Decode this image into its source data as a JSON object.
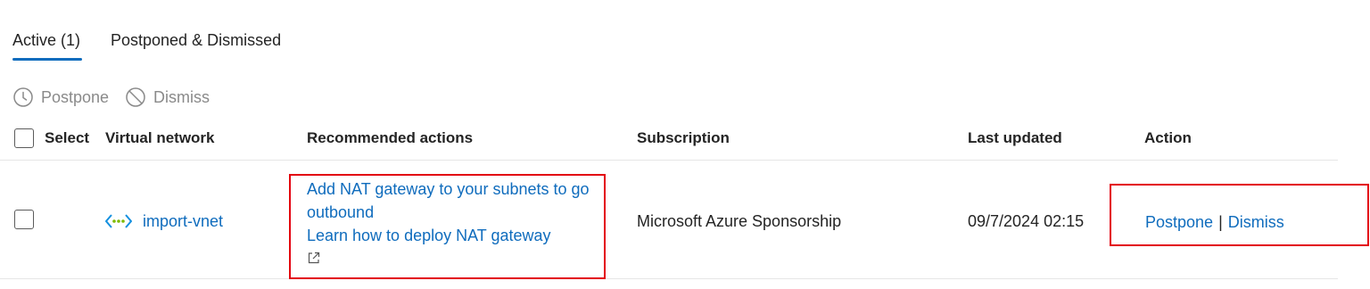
{
  "tabs": [
    {
      "label": "Active (1)",
      "active": true
    },
    {
      "label": "Postponed & Dismissed",
      "active": false
    }
  ],
  "toolbar": {
    "postpone_label": "Postpone",
    "dismiss_label": "Dismiss"
  },
  "table": {
    "headers": {
      "select": "Select",
      "virtual_network": "Virtual network",
      "recommended_actions": "Recommended actions",
      "subscription": "Subscription",
      "last_updated": "Last updated",
      "action": "Action"
    },
    "rows": [
      {
        "virtual_network": "import-vnet",
        "recommended_action_line1": "Add NAT gateway to your subnets to go",
        "recommended_action_line2": "outbound",
        "learn_link": "Learn how to deploy NAT gateway",
        "subscription": "Microsoft Azure Sponsorship",
        "last_updated": "09/7/2024 02:15",
        "postpone_label": "Postpone",
        "action_separator": "|",
        "dismiss_label": "Dismiss"
      }
    ]
  },
  "colors": {
    "link": "#0f6cbd",
    "tab_underline": "#0f6cbd",
    "highlight_box": "#e3000f",
    "disabled_text": "#8a8a8a"
  },
  "icons": [
    "clock-icon",
    "prohibited-icon",
    "virtual-network-icon",
    "external-link-icon"
  ]
}
